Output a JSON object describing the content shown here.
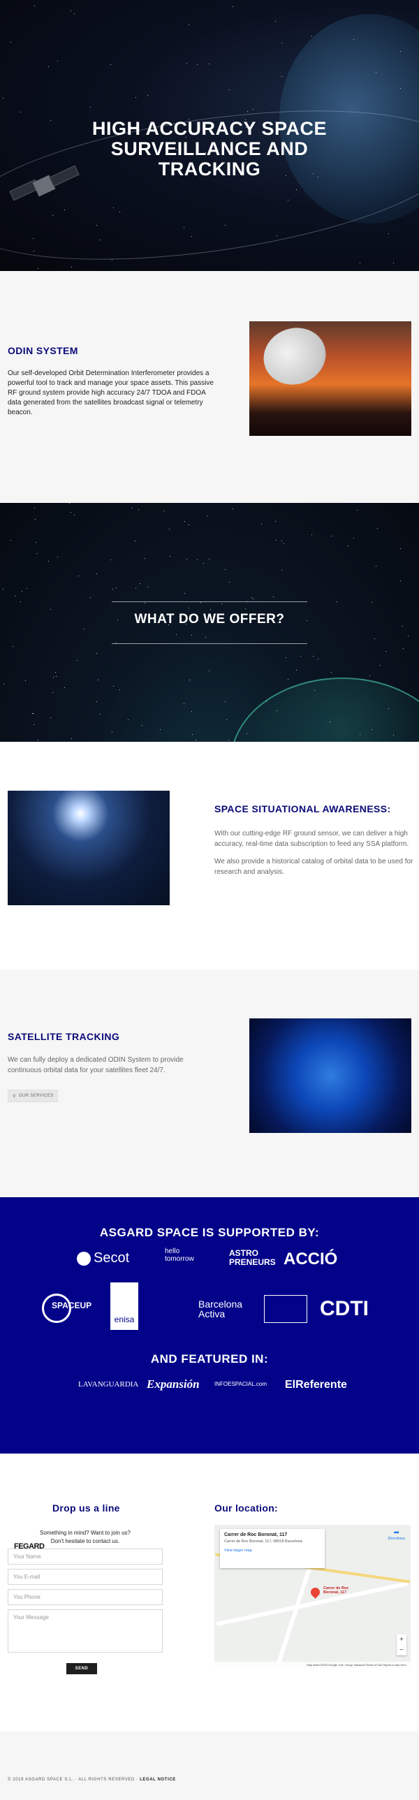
{
  "hero": {
    "title_line1": "HIGH ACCURACY SPACE",
    "title_line2": "SURVEILLANCE AND",
    "title_line3": "TRACKING"
  },
  "odin": {
    "heading": "ODIN SYSTEM",
    "body": "Our self-developed Orbit Determination Interferometer provides a powerful tool to track and manage your space assets. This passive RF ground system provide high accuracy 24/7 TDOA and FDOA data generated from the satellites broadcast signal or telemetry beacon."
  },
  "offer": {
    "heading": "WHAT DO WE OFFER?"
  },
  "ssa": {
    "heading": "SPACE SITUATIONAL AWARENESS:",
    "p1": "With our cutting-edge RF ground sensor, we can deliver a high accuracy, real-time data subscription to feed any SSA platform.",
    "p2": "We also provide a historical catalog of orbital data to be used for research and analysis."
  },
  "tracking": {
    "heading": "SATELLITE TRACKING",
    "body": "We can fully deploy a dedicated ODIN System to provide continuous orbital data for your satellites fleet 24/7.",
    "button": "OUR SERVICES"
  },
  "support": {
    "heading": "ASGARD SPACE IS SUPPORTED BY:",
    "logos_row1": [
      "Secot",
      "hello",
      "tomorrow",
      "ASTRO",
      "PRENEURS",
      "ACCIÓ"
    ],
    "logos_row2": [
      "SPACEUP",
      "enisa",
      "Barcelona",
      "Activa",
      "CDTI"
    ],
    "featured_heading": "AND FEATURED IN:",
    "featured": [
      "LAVANGUARDIA",
      "Expansión",
      "INFOESPACIAL.com",
      "ElReferente"
    ]
  },
  "contact": {
    "heading": "Drop us a line",
    "note_line1": "Something in mind? Want to join us?",
    "note_line2": "Don't hesitate to contact us.",
    "name_placeholder": "Your Name",
    "email_placeholder": "You E-mail",
    "phone_placeholder": "You Phone",
    "message_placeholder": "Your Message",
    "send_label": "SEND",
    "badge": "FEGARD"
  },
  "location": {
    "heading": "Our location:",
    "map_place": "Carrer de Roc Boronat, 117",
    "map_address": "Carrer de Roc Boronat, 117, 08018 Barcelona",
    "map_view": "View larger map",
    "map_directions": "Directions",
    "pin_label": "Carrer de Roc Boronat, 117",
    "map_footer": "Map data ©2019 Google, Inst. Geogr. Nacional   Terms of Use   Report a map error"
  },
  "footer": {
    "copyright": "© 2019 ASGARD SPACE S.L. · ALL RIGHTS RESERVED · ",
    "legal": "LEGAL NOTICE"
  }
}
